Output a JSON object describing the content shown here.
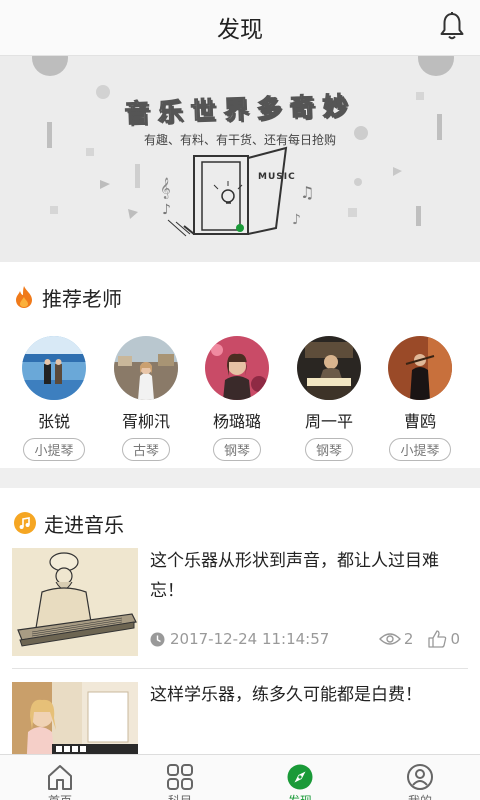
{
  "header": {
    "title": "发现"
  },
  "banner": {
    "headline": "音乐世界多奇妙",
    "subtitle": "有趣、有料、有干货、还有每日抢购",
    "door_sign": "MUSIC"
  },
  "teachers_section": {
    "title": "推荐老师",
    "teachers": [
      {
        "name": "张锐",
        "instrument": "小提琴"
      },
      {
        "name": "胥柳汛",
        "instrument": "古琴"
      },
      {
        "name": "杨璐璐",
        "instrument": "钢琴"
      },
      {
        "name": "周一平",
        "instrument": "钢琴"
      },
      {
        "name": "曹鸥",
        "instrument": "小提琴"
      }
    ]
  },
  "music_section": {
    "title": "走进音乐",
    "articles": [
      {
        "title": "这个乐器从形状到声音，都让人过目难忘！",
        "time": "2017-12-24 11:14:57",
        "views": "2",
        "likes": "0"
      },
      {
        "title": "这样学乐器，练多久可能都是白费！"
      }
    ]
  },
  "tabbar": {
    "tabs": [
      {
        "label": "首页",
        "icon": "home-icon"
      },
      {
        "label": "科目",
        "icon": "grid-icon"
      },
      {
        "label": "发现",
        "icon": "compass-icon"
      },
      {
        "label": "我的",
        "icon": "user-icon"
      }
    ],
    "active_color": "#1a9a38"
  }
}
